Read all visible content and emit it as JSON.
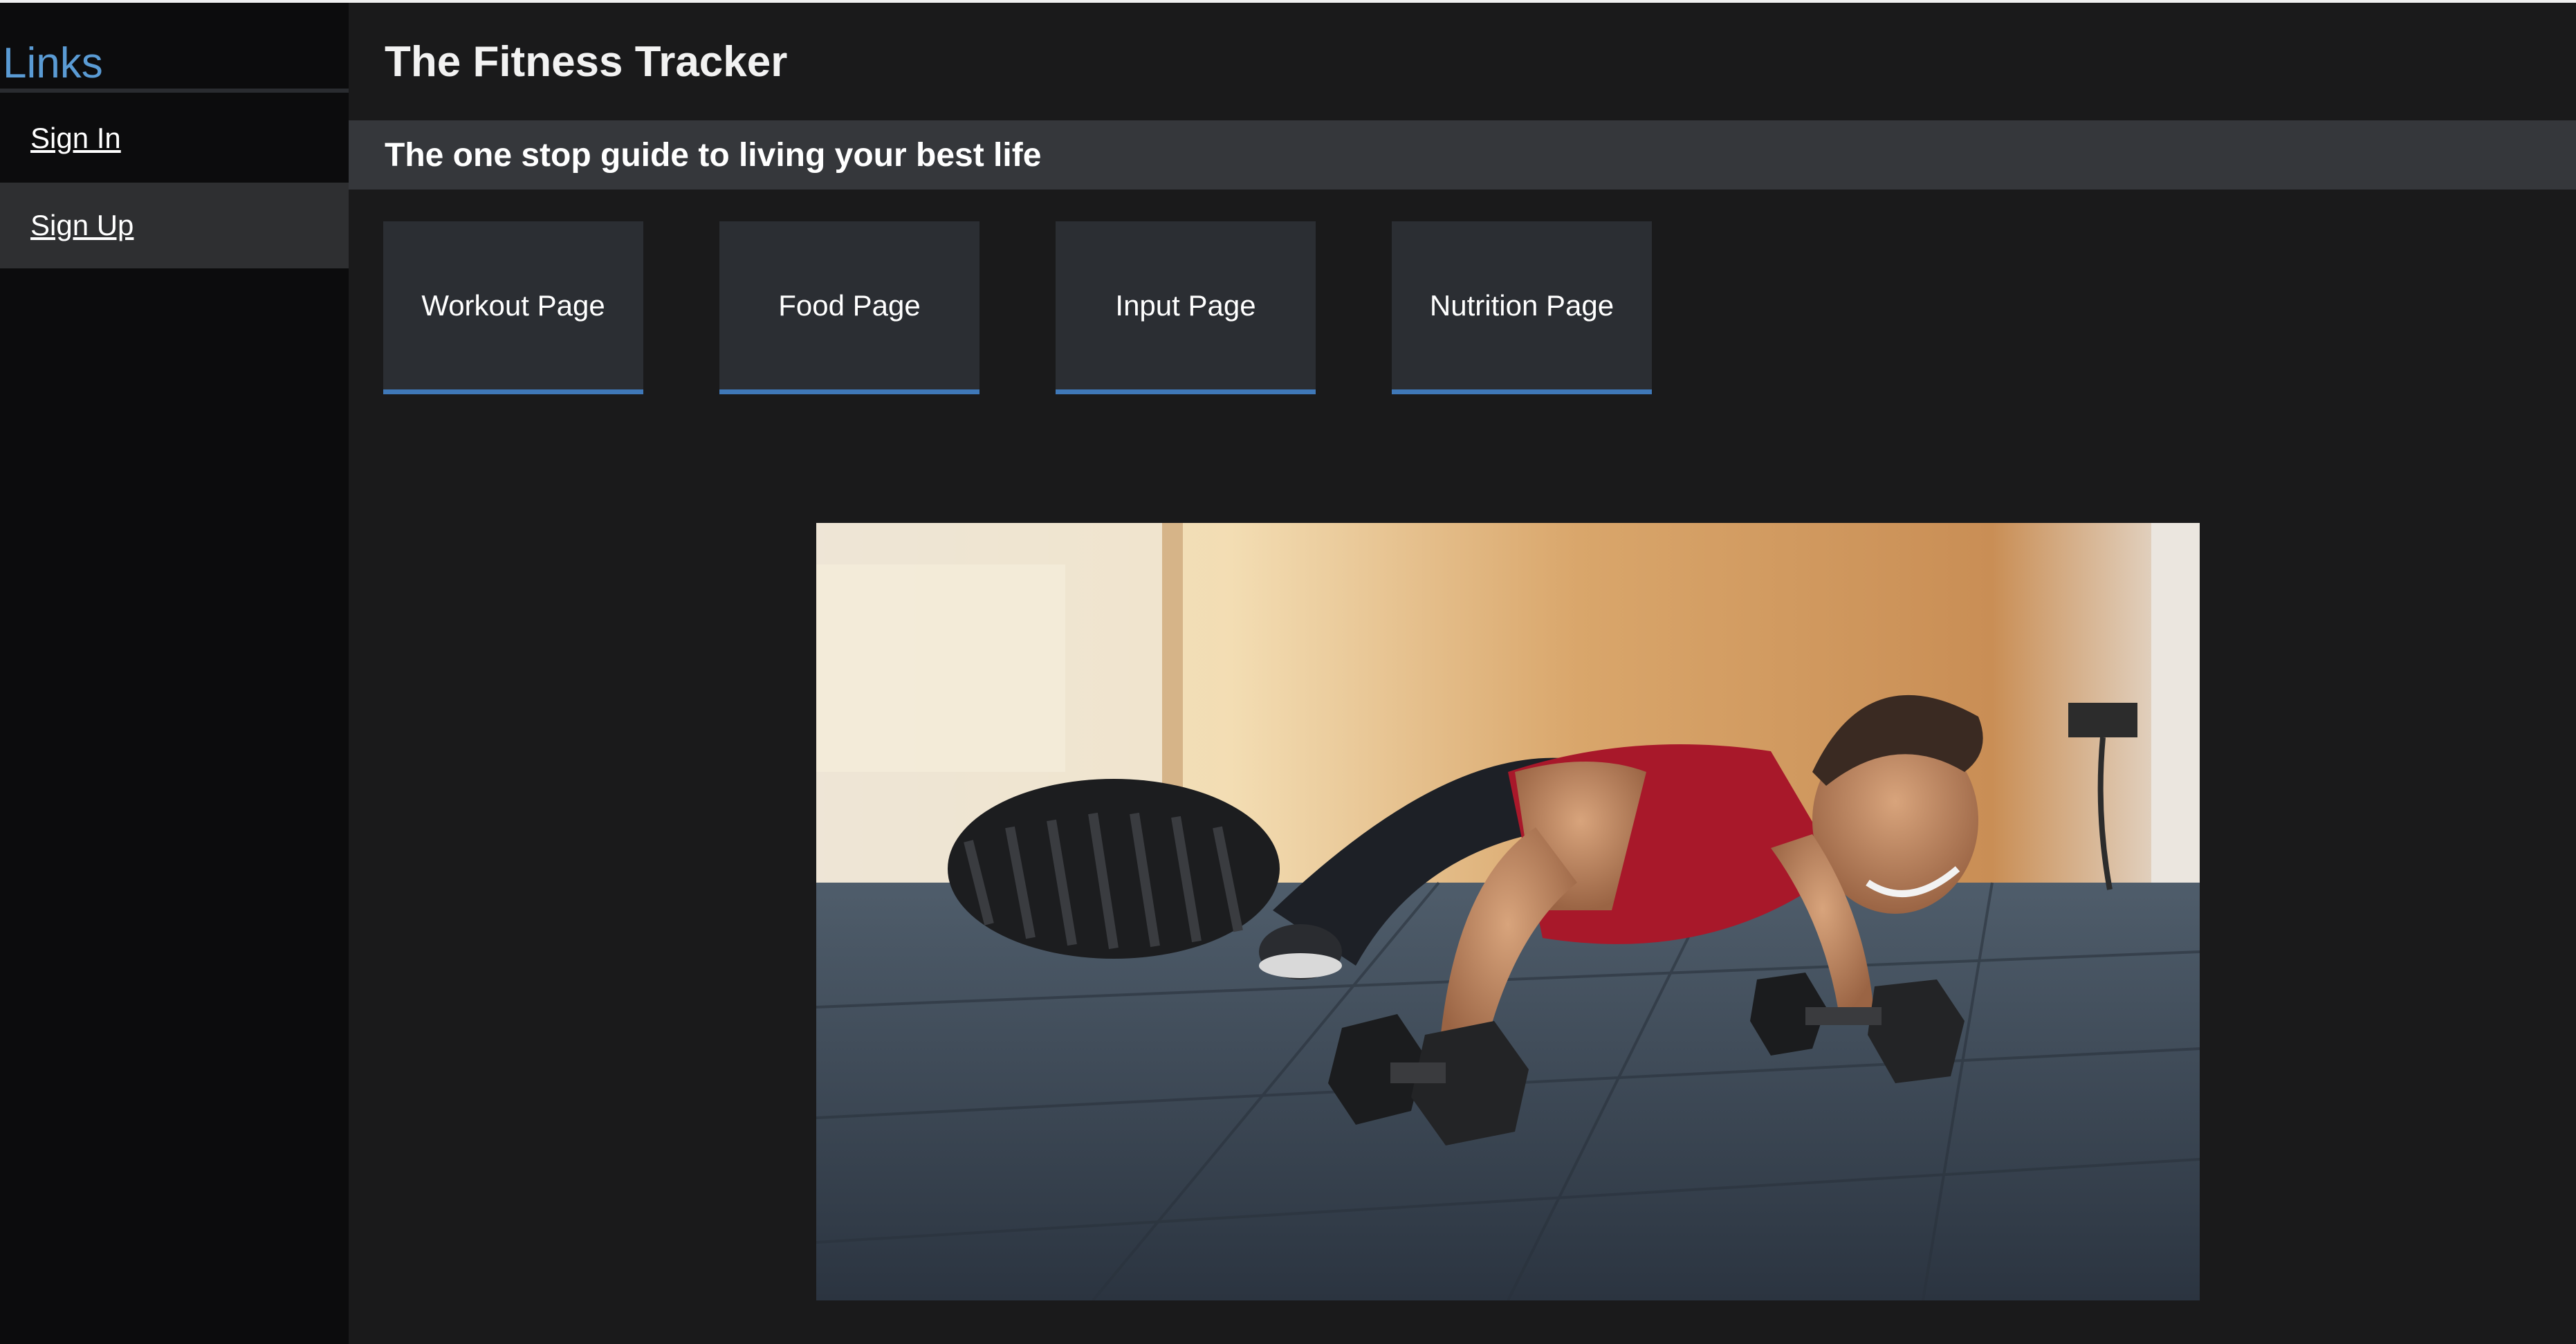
{
  "sidebar": {
    "title": "Links",
    "items": [
      {
        "label": "Sign In"
      },
      {
        "label": "Sign Up"
      }
    ]
  },
  "header": {
    "title": "The Fitness Tracker",
    "subtitle": "The one stop guide to living your best life"
  },
  "nav_tiles": [
    {
      "label": "Workout Page"
    },
    {
      "label": "Food Page"
    },
    {
      "label": "Input Page"
    },
    {
      "label": "Nutrition Page"
    }
  ],
  "colors": {
    "accent": "#5a9bd4",
    "tile_underline": "#3f78b8",
    "background": "#1a1a1b",
    "sidebar": "#0c0c0d"
  }
}
